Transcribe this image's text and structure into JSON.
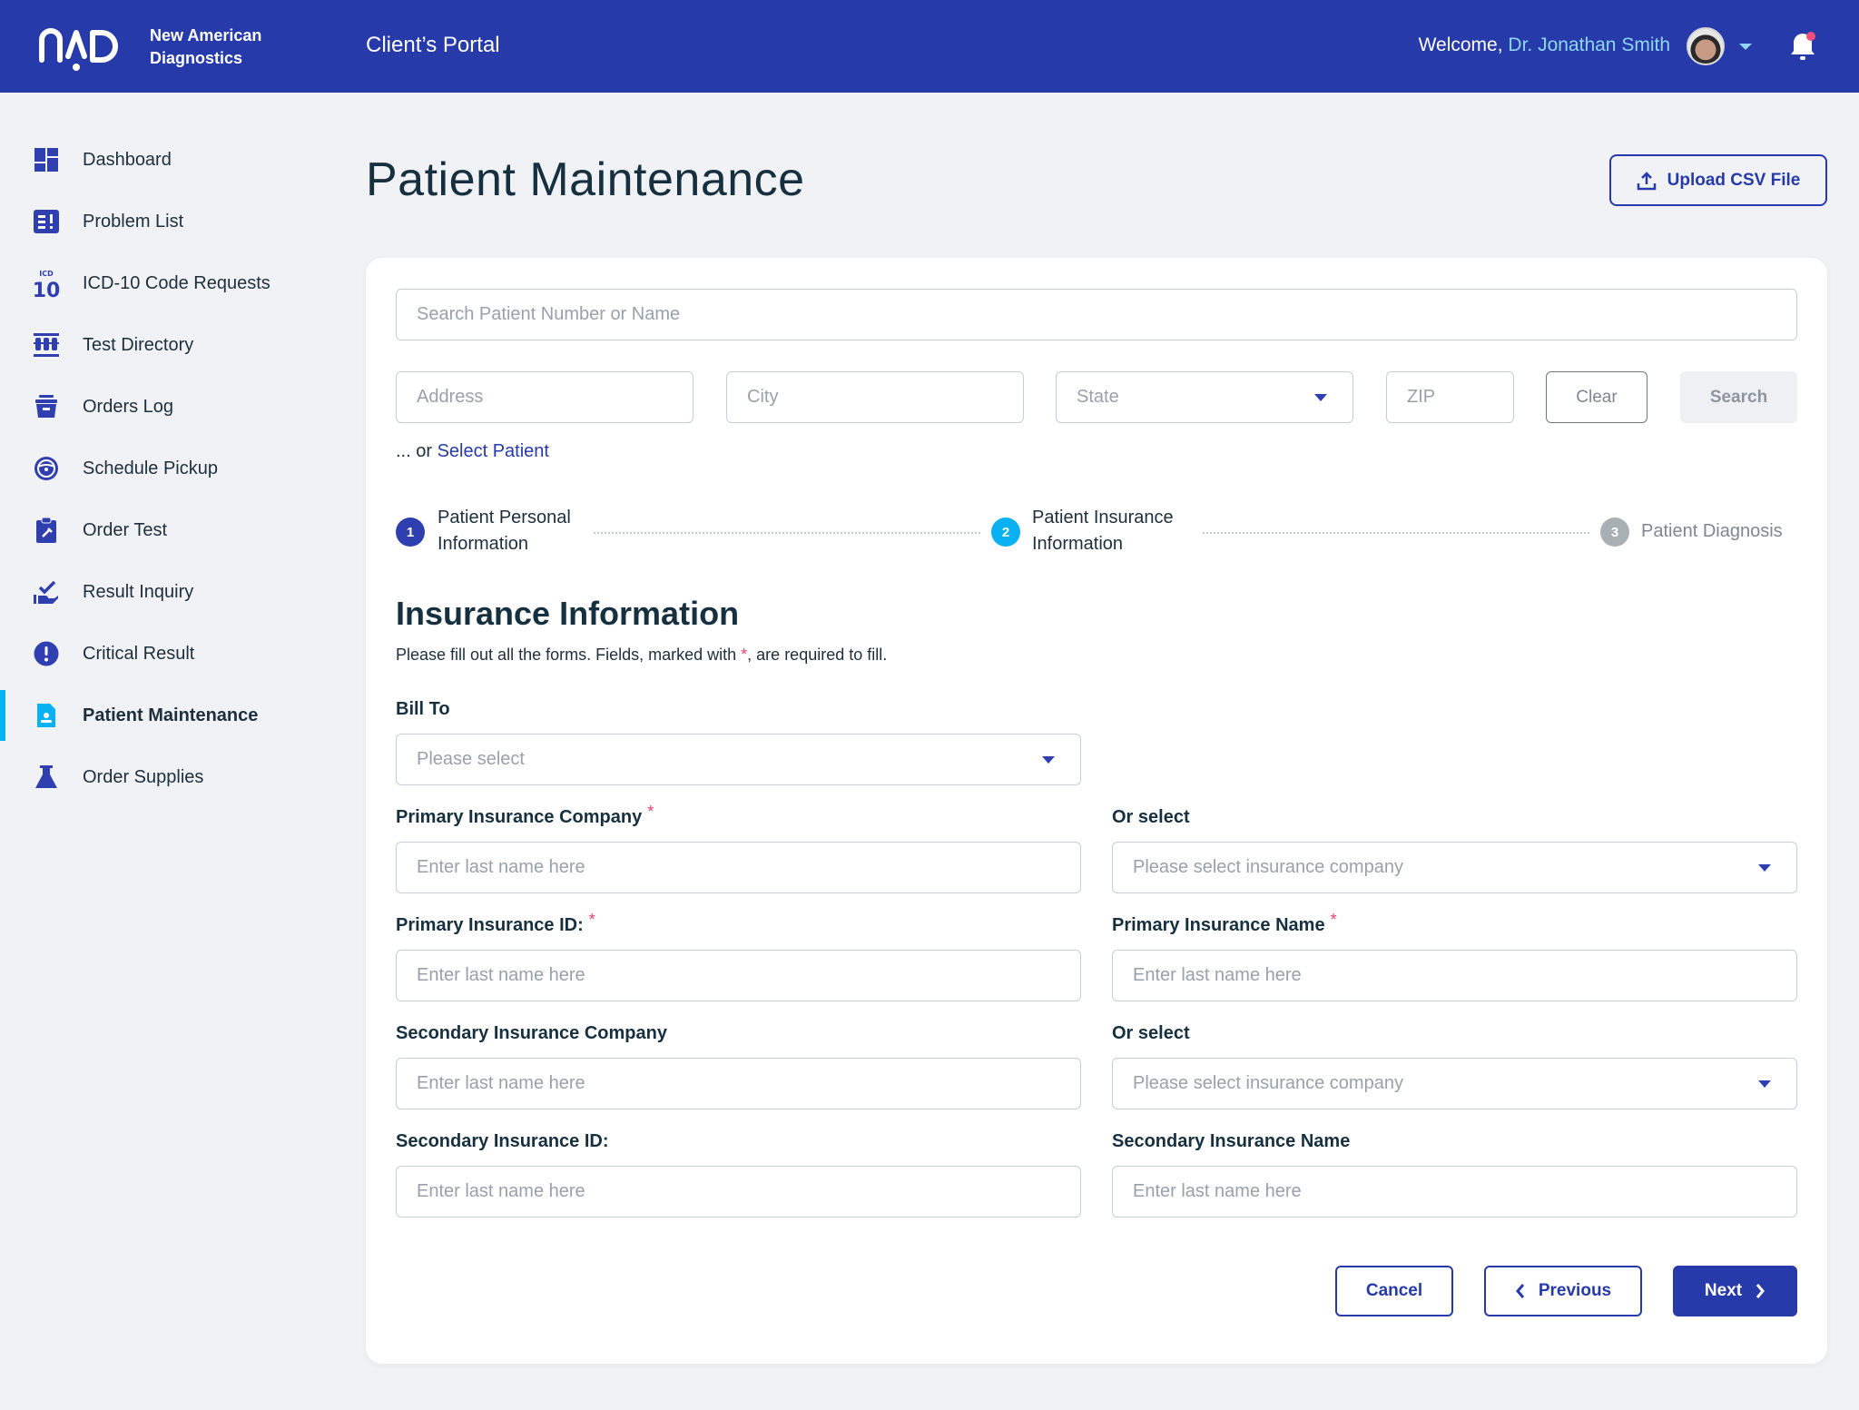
{
  "header": {
    "brand_line1": "New American",
    "brand_line2": "Diagnostics",
    "portal_title": "Client’s Portal",
    "welcome_prefix": "Welcome, ",
    "user_name": "Dr. Jonathan Smith",
    "logo_icon": "nad-logo",
    "notification_icon": "bell-icon"
  },
  "sidebar": {
    "items": [
      {
        "label": "Dashboard",
        "icon": "dashboard-icon"
      },
      {
        "label": "Problem List",
        "icon": "problem-list-icon"
      },
      {
        "label": "ICD-10 Code Requests",
        "icon": "icd10-icon"
      },
      {
        "label": "Test Directory",
        "icon": "test-tubes-icon"
      },
      {
        "label": "Orders Log",
        "icon": "archive-icon"
      },
      {
        "label": "Schedule Pickup",
        "icon": "steering-wheel-icon"
      },
      {
        "label": "Order Test",
        "icon": "clipboard-icon"
      },
      {
        "label": "Result Inquiry",
        "icon": "hand-check-icon"
      },
      {
        "label": "Critical Result",
        "icon": "alert-circle-icon"
      },
      {
        "label": "Patient Maintenance",
        "icon": "patient-file-icon",
        "active": true
      },
      {
        "label": "Order Supplies",
        "icon": "flask-icon"
      }
    ]
  },
  "page": {
    "title": "Patient Maintenance",
    "upload_label": "Upload CSV File"
  },
  "search": {
    "main_placeholder": "Search Patient Number or Name",
    "address_placeholder": "Address",
    "city_placeholder": "City",
    "state_placeholder": "State",
    "zip_placeholder": "ZIP",
    "clear_label": "Clear",
    "search_label": "Search",
    "or_prefix": "... or ",
    "select_patient_link": "Select Patient"
  },
  "stepper": {
    "steps": [
      {
        "number": "1",
        "line1": "Patient Personal",
        "line2": "Information",
        "status": "completed"
      },
      {
        "number": "2",
        "line1": "Patient Insurance",
        "line2": "Information",
        "status": "current"
      },
      {
        "number": "3",
        "line1": "Patient Diagnosis",
        "line2": "",
        "status": "pending"
      }
    ]
  },
  "form": {
    "title": "Insurance Information",
    "subtitle_before": "Please fill out all the forms. Fields, marked with ",
    "subtitle_star": "*",
    "subtitle_after": ", are required to fill.",
    "bill_to": {
      "label": "Bill To",
      "placeholder": "Please select"
    },
    "primary_company": {
      "label": "Primary Insurance Company",
      "required": "*",
      "placeholder": "Enter last name here"
    },
    "primary_or_select": {
      "label": "Or select",
      "placeholder": "Please select insurance company"
    },
    "primary_id": {
      "label": "Primary Insurance ID:",
      "required": "*",
      "placeholder": "Enter last name here"
    },
    "primary_name": {
      "label": "Primary Insurance Name",
      "required": "*",
      "placeholder": "Enter last name here"
    },
    "secondary_company": {
      "label": "Secondary Insurance Company",
      "placeholder": "Enter last name here"
    },
    "secondary_or_select": {
      "label": "Or select",
      "placeholder": "Please select insurance company"
    },
    "secondary_id": {
      "label": "Secondary Insurance ID:",
      "placeholder": "Enter last name here"
    },
    "secondary_name": {
      "label": "Secondary Insurance Name",
      "placeholder": "Enter last name here"
    }
  },
  "actions": {
    "cancel_label": "Cancel",
    "previous_label": "Previous",
    "next_label": "Next"
  },
  "colors": {
    "brand_blue": "#263aa9",
    "active_accent": "#08b1f2",
    "required_star": "#e83e6c",
    "step_pending": "#a8b0b6"
  }
}
